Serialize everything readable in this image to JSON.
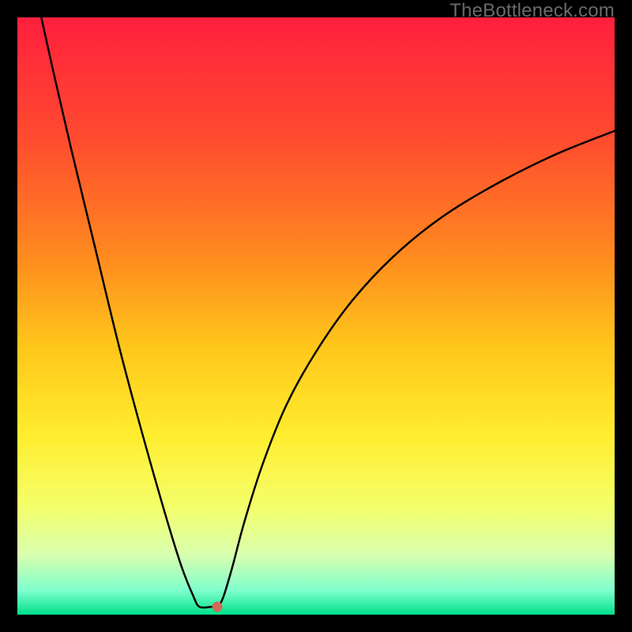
{
  "watermark": "TheBottleneck.com",
  "chart_data": {
    "type": "line",
    "title": "",
    "xlabel": "",
    "ylabel": "",
    "xlim": [
      0,
      100
    ],
    "ylim": [
      0,
      100
    ],
    "grid": false,
    "legend": false,
    "background": {
      "type": "vertical-gradient",
      "stops": [
        {
          "pos": 0.0,
          "color": "#ff1f3d"
        },
        {
          "pos": 0.2,
          "color": "#ff4a2f"
        },
        {
          "pos": 0.4,
          "color": "#ff8a1f"
        },
        {
          "pos": 0.55,
          "color": "#ffc61a"
        },
        {
          "pos": 0.7,
          "color": "#ffed2e"
        },
        {
          "pos": 0.82,
          "color": "#f4ff6b"
        },
        {
          "pos": 0.9,
          "color": "#d8ffae"
        },
        {
          "pos": 0.96,
          "color": "#7dffcd"
        },
        {
          "pos": 1.0,
          "color": "#00e08a"
        }
      ]
    },
    "series": [
      {
        "name": "bottleneck-curve",
        "color": "#000000",
        "width": 2.5,
        "points": [
          {
            "x": 4.0,
            "y": 100.0
          },
          {
            "x": 6.0,
            "y": 91.0
          },
          {
            "x": 9.0,
            "y": 78.0
          },
          {
            "x": 13.0,
            "y": 61.5
          },
          {
            "x": 17.0,
            "y": 45.0
          },
          {
            "x": 21.0,
            "y": 30.0
          },
          {
            "x": 25.0,
            "y": 16.0
          },
          {
            "x": 27.5,
            "y": 8.0
          },
          {
            "x": 29.5,
            "y": 3.0
          },
          {
            "x": 30.5,
            "y": 1.3
          },
          {
            "x": 32.5,
            "y": 1.3
          },
          {
            "x": 33.5,
            "y": 1.3
          },
          {
            "x": 34.5,
            "y": 3.0
          },
          {
            "x": 36.0,
            "y": 8.0
          },
          {
            "x": 38.0,
            "y": 15.5
          },
          {
            "x": 41.0,
            "y": 25.0
          },
          {
            "x": 45.0,
            "y": 35.0
          },
          {
            "x": 50.0,
            "y": 44.0
          },
          {
            "x": 56.0,
            "y": 52.5
          },
          {
            "x": 63.0,
            "y": 60.0
          },
          {
            "x": 71.0,
            "y": 66.5
          },
          {
            "x": 80.0,
            "y": 72.0
          },
          {
            "x": 90.0,
            "y": 77.0
          },
          {
            "x": 100.0,
            "y": 81.0
          }
        ]
      }
    ],
    "markers": [
      {
        "name": "optimal-dot",
        "x": 33.5,
        "y": 1.3,
        "color": "#cf6b56"
      }
    ]
  }
}
